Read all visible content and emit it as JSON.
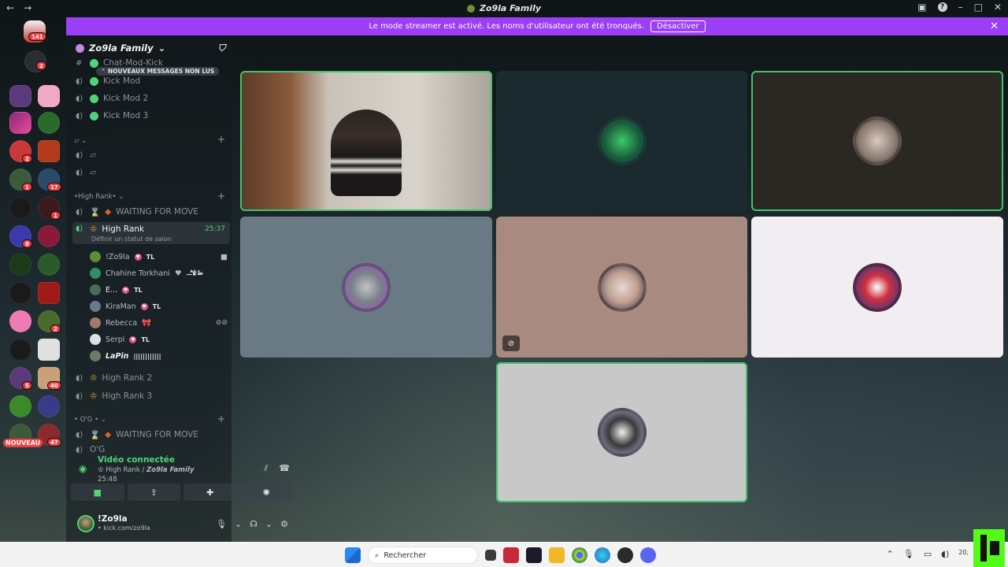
{
  "window": {
    "title": "Zo9la Family",
    "nav_back": "←",
    "nav_forward": "→"
  },
  "banner": {
    "text": "Le mode streamer est activé. Les noms d'utilisateur ont été tronqués.",
    "button": "Désactiver"
  },
  "rail": {
    "dm_badge": "141",
    "second_badge": "2",
    "nouveau": "NOUVEAU",
    "badges": [
      "2",
      "1",
      "17",
      "1",
      "8",
      "2",
      "5",
      "40",
      "47"
    ]
  },
  "server": {
    "name": "Zo9la Family",
    "unread_pill": "NOUVEAUX MESSAGES NON LUS"
  },
  "channels": {
    "top_text_channel": "Chat-Mod-Kick",
    "kick_mod": "Kick Mod",
    "kick_mod_2": "Kick Mod 2",
    "kick_mod_3": "Kick Mod 3",
    "high_rank_category": "•High Rank•",
    "waiting": "WAITING FOR MOVE",
    "high_rank": "High Rank",
    "high_rank_time": "25:37",
    "high_rank_status": "Définir un statut de salon",
    "high_rank_2": "High Rank 2",
    "high_rank_3": "High Rank 3",
    "og_category": "• O'G •",
    "waiting_2": "WAITING FOR MOVE",
    "og": "O'G"
  },
  "voice_users": [
    {
      "name": "!Zo9la",
      "tag": "TL",
      "color": "#5b8f3a"
    },
    {
      "name": "Chahine Torkhani",
      "tag": "ظ۩ـۗـﮧ",
      "color": "#2f8f6a"
    },
    {
      "name": "E...",
      "tag": "TL",
      "color": "#4a6a5a"
    },
    {
      "name": "KiraMan",
      "tag": "TL",
      "color": "#6a7a8a"
    },
    {
      "name": "Rebecca",
      "tag": "🎀",
      "color": "#a07a6a"
    },
    {
      "name": "Serpi",
      "tag": "TL",
      "color": "#e0e0e0"
    },
    {
      "name": "LaPin",
      "tag": "||||||||||||",
      "color": "#6a7a6a"
    }
  ],
  "voice_panel": {
    "status": "Vidéo connectée",
    "channel": "High Rank / ",
    "server": "Zo9la Family",
    "timer": "25:48"
  },
  "user_panel": {
    "name": "!Zo9la",
    "url": "• kick.com/zo9la"
  },
  "taskbar": {
    "search_placeholder": "Rechercher",
    "clock": "20,"
  },
  "colors": {
    "accent_green": "#43c26b",
    "banner_purple": "#9b3ef5",
    "kick_green": "#53fc18"
  }
}
